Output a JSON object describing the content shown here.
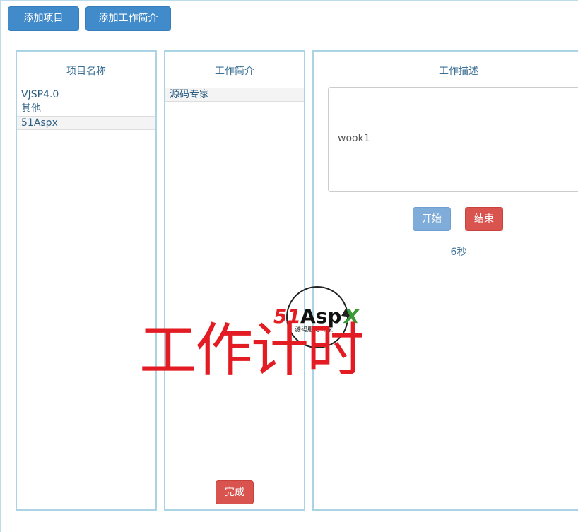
{
  "toolbar": {
    "add_project_label": "添加项目",
    "add_work_summary_label": "添加工作简介"
  },
  "projects": {
    "title": "项目名称",
    "items": [
      "VJSP4.0",
      "其他",
      "51Aspx"
    ],
    "selected_index": 2
  },
  "summaries": {
    "title": "工作简介",
    "items": [
      "源码专家"
    ],
    "selected_index": 0,
    "done_label": "完成"
  },
  "description": {
    "title": "工作描述",
    "value": "wook1",
    "start_label": "开始",
    "end_label": "结束",
    "elapsed": "6秒"
  },
  "watermark": {
    "logo_brand_51": "51",
    "logo_brand_asp": "Asp",
    "logo_brand_x": "X",
    "logo_tagline": "源码服务专家",
    "title": "工作计时"
  },
  "colors": {
    "primary": "#428bca",
    "danger": "#d9534f",
    "panel_border": "#aad4e4",
    "text_link": "#2d5f84",
    "watermark_red": "#e31b23",
    "logo_green": "#3a9a35"
  }
}
